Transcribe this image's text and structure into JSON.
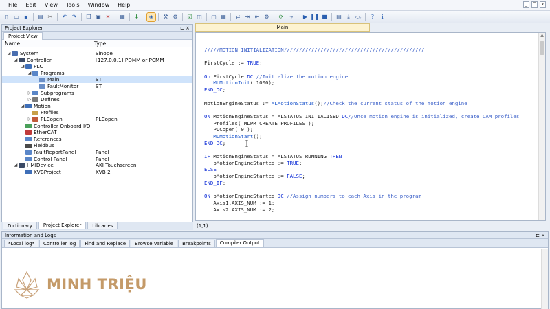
{
  "menu": [
    "File",
    "Edit",
    "View",
    "Tools",
    "Window",
    "Help"
  ],
  "toolbar_icons": [
    "new-icon",
    "open-icon",
    "save-icon",
    "sep",
    "print-icon",
    "cut-icon",
    "sep",
    "undo-icon",
    "redo-icon",
    "sep",
    "copy-icon",
    "paste-icon",
    "delete-icon",
    "sep",
    "build-icon",
    "sep",
    "download-icon",
    "sep",
    "debug-icon",
    "sep",
    "tools-icon",
    "config-icon",
    "sep",
    "check-icon",
    "split-icon",
    "sep",
    "monitor-icon",
    "grid-icon",
    "sep",
    "connect-icon",
    "login-icon",
    "logout-icon",
    "settings-icon",
    "sep",
    "run-icon",
    "step-icon",
    "sep",
    "play-icon",
    "pause-icon",
    "stop-icon",
    "sep",
    "frame-icon",
    "step-into-icon",
    "step-over-icon",
    "sep",
    "help-icon",
    "info-icon"
  ],
  "project_panel": {
    "title": "Project Explorer",
    "tab": "Project View",
    "col_name": "Name",
    "col_type": "Type",
    "items": [
      {
        "label": "System",
        "type": "Sinope",
        "level": 0,
        "exp": "◢",
        "color": "#4a6fb0"
      },
      {
        "label": "Controller",
        "type": "[127.0.0.1] PDMM or PCMM",
        "level": 1,
        "exp": "◢",
        "color": "#3b4a66"
      },
      {
        "label": "PLC",
        "type": "",
        "level": 2,
        "exp": "◢",
        "color": "#3f6fb8"
      },
      {
        "label": "Programs",
        "type": "",
        "level": 3,
        "exp": "◢",
        "color": "#5a86c8"
      },
      {
        "label": "Main",
        "type": "ST",
        "level": 4,
        "exp": "",
        "color": "#6a8fc8",
        "selected": true
      },
      {
        "label": "FaultMonitor",
        "type": "ST",
        "level": 4,
        "exp": "",
        "color": "#6a8fc8"
      },
      {
        "label": "Subprograms",
        "type": "",
        "level": 3,
        "exp": "▷",
        "color": "#5a86c8"
      },
      {
        "label": "Defines",
        "type": "",
        "level": 3,
        "exp": "▷",
        "color": "#7a7a7a"
      },
      {
        "label": "Motion",
        "type": "",
        "level": 2,
        "exp": "◢",
        "color": "#3f6fb8"
      },
      {
        "label": "Profiles",
        "type": "",
        "level": 3,
        "exp": "",
        "color": "#c8a048"
      },
      {
        "label": "PLCopen",
        "type": "PLCopen",
        "level": 3,
        "exp": "▷",
        "color": "#c05a3a"
      },
      {
        "label": "Controller Onboard I/O",
        "type": "",
        "level": 2,
        "exp": "",
        "color": "#4aa05a"
      },
      {
        "label": "EtherCAT",
        "type": "",
        "level": 2,
        "exp": "",
        "color": "#c03a3a"
      },
      {
        "label": "References",
        "type": "",
        "level": 2,
        "exp": "",
        "color": "#5a86c8"
      },
      {
        "label": "Fieldbus",
        "type": "",
        "level": 2,
        "exp": "",
        "color": "#4a4a4a"
      },
      {
        "label": "FaultReportPanel",
        "type": "Panel",
        "level": 2,
        "exp": "",
        "color": "#5a86c8"
      },
      {
        "label": "Control Panel",
        "type": "Panel",
        "level": 2,
        "exp": "",
        "color": "#5a86c8"
      },
      {
        "label": "HMIDevice",
        "type": "AKI Touchscreen",
        "level": 1,
        "exp": "◢",
        "color": "#3b4a66"
      },
      {
        "label": "KVBProject",
        "type": "KVB 2",
        "level": 2,
        "exp": "",
        "color": "#3f6fb8"
      }
    ],
    "bottom_tabs": [
      {
        "label": "Dictionary",
        "active": false
      },
      {
        "label": "Project Explorer",
        "active": true
      },
      {
        "label": "Libraries",
        "active": false
      }
    ]
  },
  "editor": {
    "tab": "Main",
    "status": "(1,1)",
    "lines": [
      [
        [
          "cm",
          "/////MOTION INITIALIZATION//////////////////////////////////////////////"
        ]
      ],
      [],
      [
        [
          "",
          "FirstCycle := "
        ],
        [
          "kw",
          "TRUE"
        ],
        [
          "",
          ";"
        ]
      ],
      [],
      [
        [
          "kw",
          "On"
        ],
        [
          "",
          " FirstCycle "
        ],
        [
          "kw",
          "DC"
        ],
        [
          "cm",
          " //Initialize the motion engine"
        ]
      ],
      [
        [
          "",
          "   "
        ],
        [
          "fn",
          "MLMotionInit"
        ],
        [
          "",
          "( 1000);"
        ]
      ],
      [
        [
          "kw",
          "END_DC"
        ],
        [
          "",
          ";"
        ]
      ],
      [],
      [
        [
          "",
          "MotionEngineStatus := "
        ],
        [
          "fn",
          "MLMotionStatus"
        ],
        [
          "",
          "();"
        ],
        [
          "cm",
          "//Check the current status of the motion engine"
        ]
      ],
      [],
      [
        [
          "kw",
          "ON"
        ],
        [
          "",
          " MotionEngineStatus = MLSTATUS_INITIALISED "
        ],
        [
          "kw",
          "DC"
        ],
        [
          "cm",
          "//Once motion engine is initialized, create CAM profiles"
        ]
      ],
      [
        [
          "",
          "   Profiles( MLPR_CREATE_PROFILES );"
        ]
      ],
      [
        [
          "",
          "   PLCopen( 0 );"
        ]
      ],
      [
        [
          "",
          "   "
        ],
        [
          "fn",
          "MLMotionStart"
        ],
        [
          "",
          "();"
        ]
      ],
      [
        [
          "kw",
          "END_DC"
        ],
        [
          "",
          ";"
        ]
      ],
      [],
      [
        [
          "kw",
          "IF"
        ],
        [
          "",
          " MotionEngineStatus = MLSTATUS_RUNNING "
        ],
        [
          "kw",
          "THEN"
        ]
      ],
      [
        [
          "",
          "   bMotionEngineStarted := "
        ],
        [
          "kw",
          "TRUE"
        ],
        [
          "",
          ";"
        ]
      ],
      [
        [
          "kw",
          "ELSE"
        ]
      ],
      [
        [
          "",
          "   bMotionEngineStarted := "
        ],
        [
          "kw",
          "FALSE"
        ],
        [
          "",
          ";"
        ]
      ],
      [
        [
          "kw",
          "END_IF"
        ],
        [
          "",
          ";"
        ]
      ],
      [],
      [
        [
          "kw",
          "ON"
        ],
        [
          "",
          " bMotionEngineStarted "
        ],
        [
          "kw",
          "DC"
        ],
        [
          "cm",
          " //Assign numbers to each Axis in the program"
        ]
      ],
      [
        [
          "",
          "   Axis1.AXIS_NUM := 1;"
        ]
      ],
      [
        [
          "",
          "   Axis2.AXIS_NUM := 2;"
        ]
      ]
    ]
  },
  "info_panel": {
    "title": "Information and Logs",
    "tabs": [
      {
        "label": "*Local log*",
        "active": false
      },
      {
        "label": "Controller log",
        "active": false
      },
      {
        "label": "Find and Replace",
        "active": false
      },
      {
        "label": "Browse Variable",
        "active": false
      },
      {
        "label": "Breakpoints",
        "active": false
      },
      {
        "label": "Compiler Output",
        "active": true
      }
    ]
  },
  "watermark": {
    "text": "MINH TRIỆU",
    "color": "#c49a68"
  }
}
